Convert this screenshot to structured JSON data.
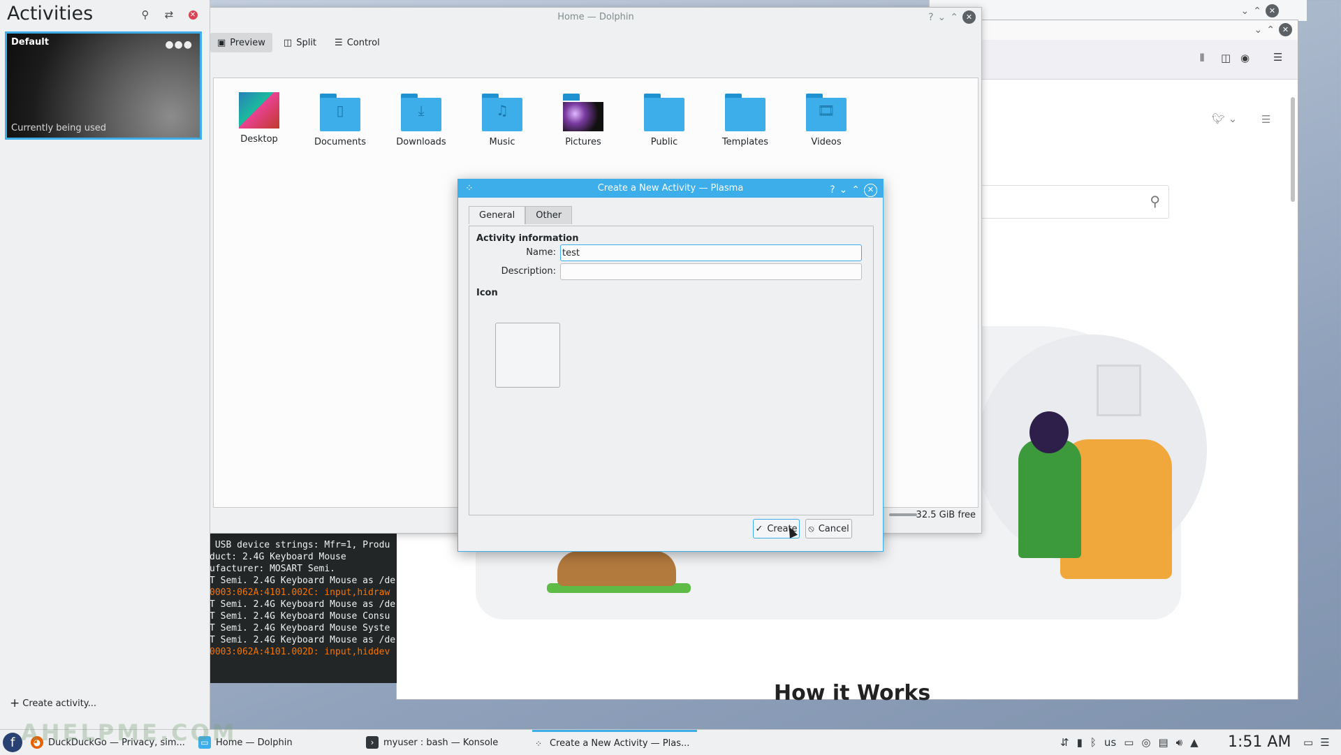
{
  "activities": {
    "title": "Activities",
    "card": {
      "name": "Default",
      "status": "Currently being used"
    },
    "create_label": "Create activity..."
  },
  "watermark": "AHELPME.COM",
  "dolphin": {
    "title": "Home — Dolphin",
    "tools": {
      "preview": "Preview",
      "split": "Split",
      "control": "Control"
    },
    "folders": [
      "Desktop",
      "Documents",
      "Downloads",
      "Music",
      "Pictures",
      "Public",
      "Templates",
      "Videos"
    ],
    "free_space": "32.5 GiB free"
  },
  "dialog": {
    "title": "Create a New Activity — Plasma",
    "tabs": [
      "General",
      "Other"
    ],
    "section_info": "Activity information",
    "name_label": "Name:",
    "name_value": "test",
    "description_label": "Description:",
    "description_value": "",
    "section_icon": "Icon",
    "create_label": "Create",
    "cancel_label": "Cancel"
  },
  "konsole": {
    "lines": [
      " USB device strings: Mfr=1, Produ",
      "duct: 2.4G Keyboard Mouse",
      "ufacturer: MOSART Semi.",
      "T Semi. 2.4G Keyboard Mouse as /de",
      "0003:062A:4101.002C: input,hidraw",
      "T Semi. 2.4G Keyboard Mouse as /de",
      "T Semi. 2.4G Keyboard Mouse Consu",
      "T Semi. 2.4G Keyboard Mouse Syste",
      "T Semi. 2.4G Keyboard Mouse as /de",
      "0003:062A:4101.002D: input,hiddev"
    ]
  },
  "browser": {
    "heading": "How it Works"
  },
  "taskbar": {
    "tasks": [
      "DuckDuckGo — Privacy, sim...",
      "Home — Dolphin",
      "myuser : bash — Konsole",
      "Create a New Activity — Plas..."
    ],
    "keyboard_layout": "us",
    "clock": "1:51 AM"
  },
  "colors": {
    "accent": "#3daee9",
    "close_red": "#da4453",
    "konsole_bg": "#232627",
    "terminal_orange": "#f67400"
  }
}
